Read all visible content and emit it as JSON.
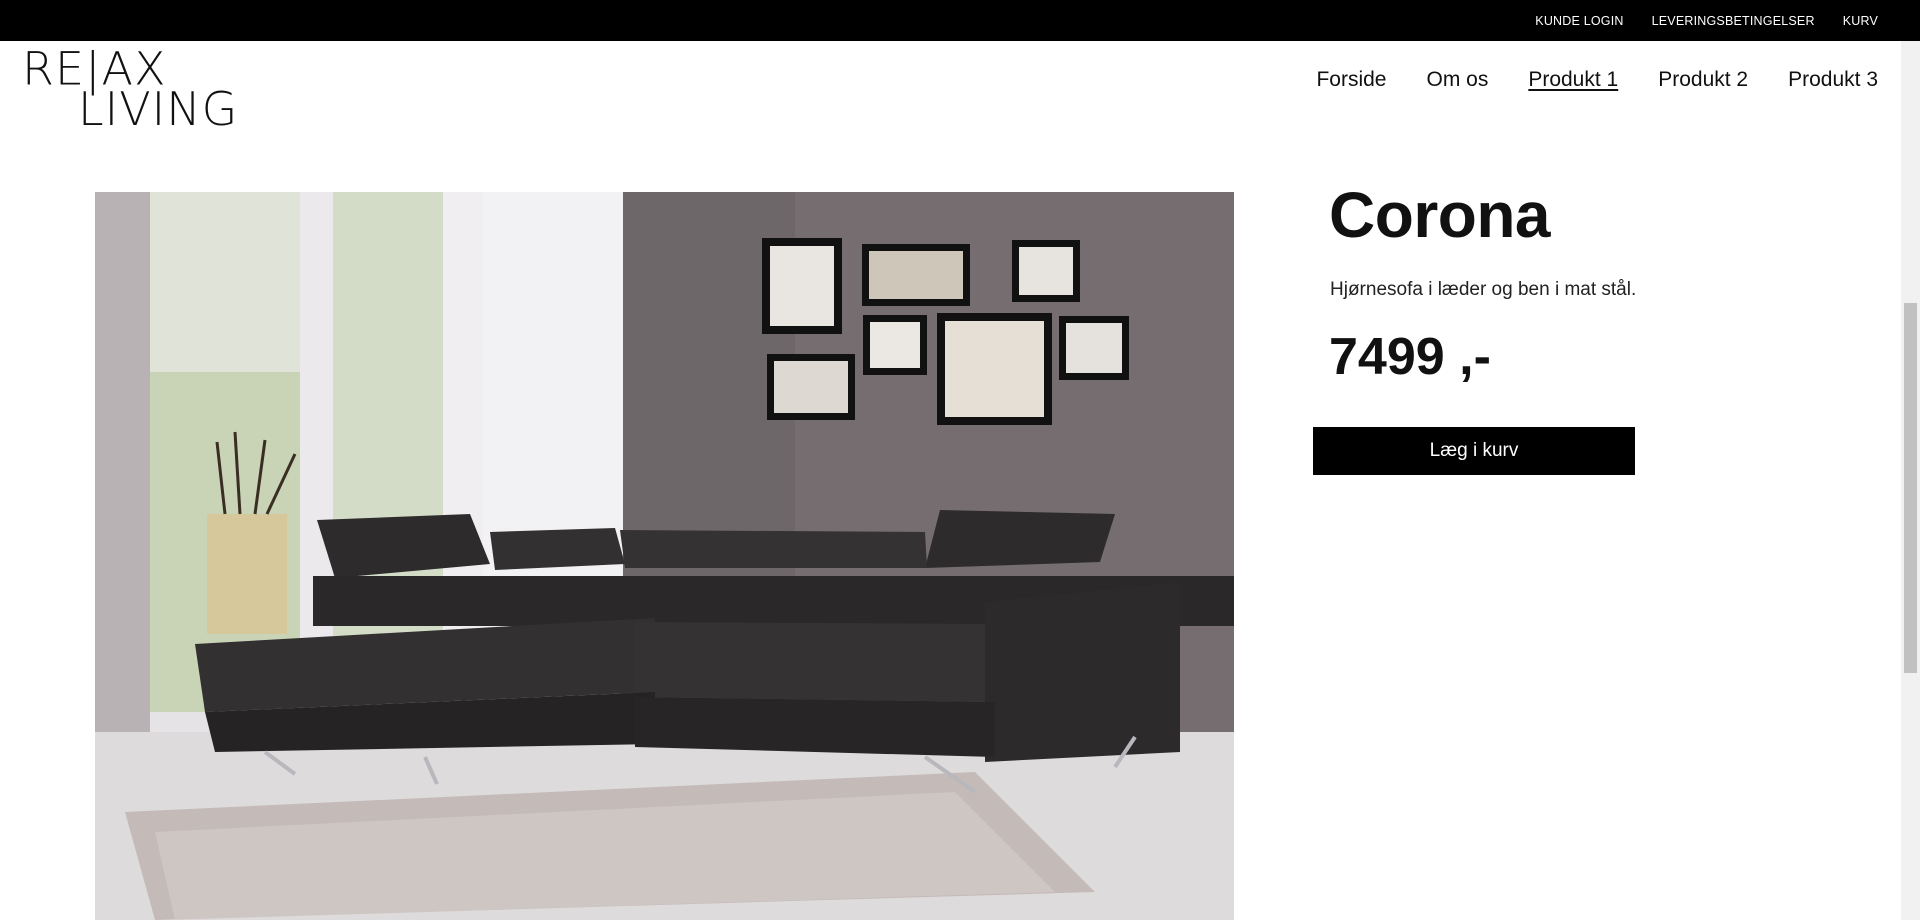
{
  "topbar": {
    "links": [
      "KUNDE LOGIN",
      "LEVERINGSBETINGELSER",
      "KURV"
    ]
  },
  "logo": {
    "line1": "RE|AX",
    "line2": "LIVING"
  },
  "nav": {
    "items": [
      "Forside",
      "Om os",
      "Produkt 1",
      "Produkt 2",
      "Produkt 3"
    ],
    "active": "Produkt 1"
  },
  "product": {
    "title": "Corona",
    "description": "Hjørnesofa i læder og ben i mat stål.",
    "price": "7499 ,-",
    "add_to_cart": "Læg i kurv"
  },
  "colors": {
    "topbar_bg": "#000000",
    "button_bg": "#000000",
    "button_text": "#ffffff"
  }
}
